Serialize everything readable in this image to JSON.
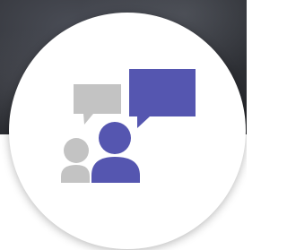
{
  "icon": {
    "name": "group-discussion-icon",
    "colors": {
      "accent": "#5556b0",
      "muted": "#c3c3c3",
      "badge_background": "#ffffff"
    }
  }
}
